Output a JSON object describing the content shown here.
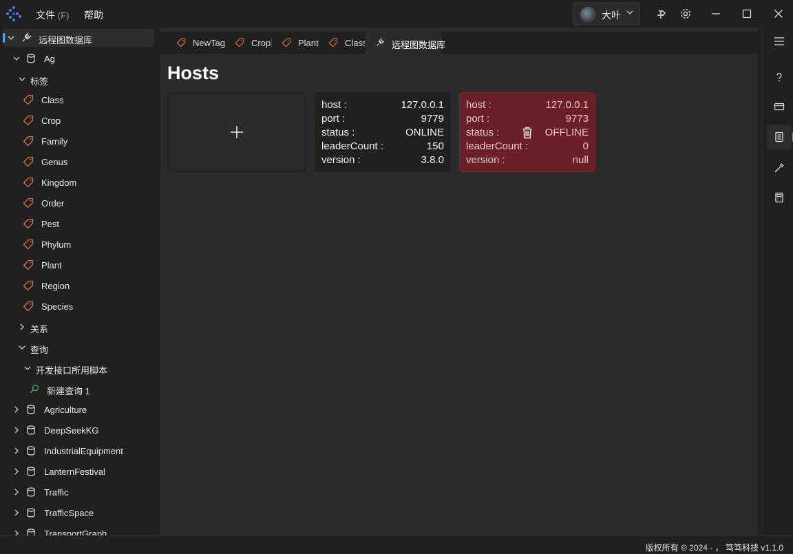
{
  "titlebar": {
    "menu_file": "文件",
    "menu_file_accel": "(F)",
    "menu_help": "帮助",
    "user_name": "大叶"
  },
  "sidebar": {
    "root_label": "远程图数据库",
    "space_ag": "Ag",
    "tags_group": "标签",
    "tags": [
      "Class",
      "Crop",
      "Family",
      "Genus",
      "Kingdom",
      "Order",
      "Pest",
      "Phylum",
      "Plant",
      "Region",
      "Species"
    ],
    "edges_group": "关系",
    "query_group": "查询",
    "query_folder": "开发接口所用脚本",
    "query_item": "新建查询 1",
    "spaces": [
      "Agriculture",
      "DeepSeekKG",
      "IndustrialEquipment",
      "LanternFestival",
      "Traffic",
      "TrafficSpace",
      "TransportGraph"
    ]
  },
  "tabs": [
    {
      "label": "NewTag",
      "icon": "tag-icon"
    },
    {
      "label": "Crop",
      "icon": "tag-icon"
    },
    {
      "label": "Plant",
      "icon": "tag-icon"
    },
    {
      "label": "Class",
      "icon": "tag-icon"
    },
    {
      "label": "远程图数据库",
      "icon": "plug-icon"
    }
  ],
  "page": {
    "title": "Hosts"
  },
  "hosts": [
    {
      "host_k": "host :",
      "host_v": "127.0.0.1",
      "port_k": "port :",
      "port_v": "9779",
      "status_k": "status :",
      "status_v": "ONLINE",
      "leader_k": "leaderCount :",
      "leader_v": "150",
      "version_k": "version :",
      "version_v": "3.8.0"
    },
    {
      "host_k": "host :",
      "host_v": "127.0.0.1",
      "port_k": "port :",
      "port_v": "9773",
      "status_k": "status :",
      "status_v": "OFFLINE",
      "leader_k": "leaderCount :",
      "leader_v": "0",
      "version_k": "version :",
      "version_v": "null"
    }
  ],
  "statusbar": {
    "text": "版权所有 © 2024 - ， 笃笃科技   v1.1.0"
  },
  "colors": {
    "accent": "#5aa2e8",
    "tag_icon": "#e0703a",
    "offline_card": "#6b1f27",
    "query_icon": "#3fae4a"
  }
}
